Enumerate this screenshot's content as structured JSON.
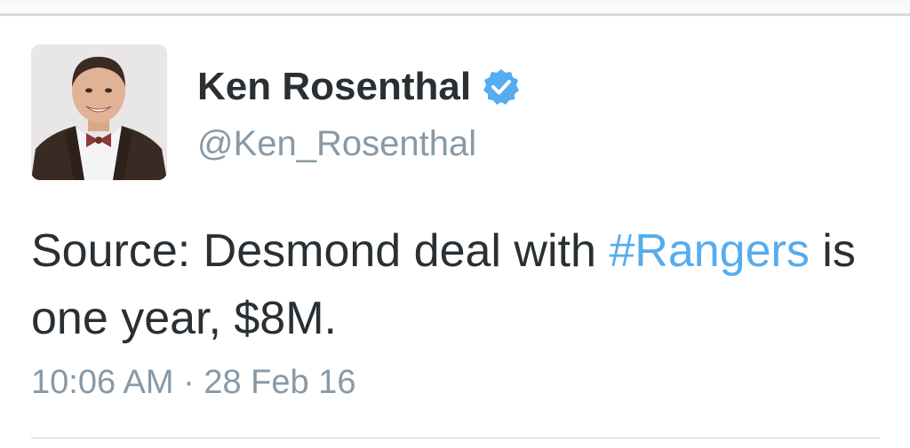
{
  "tweet": {
    "author": {
      "display_name": "Ken Rosenthal",
      "handle": "@Ken_Rosenthal",
      "verified": true,
      "verified_icon": "verified-badge-icon",
      "avatar": "profile-photo"
    },
    "text": {
      "part1": "Source: Desmond deal with ",
      "hashtag": "#Rangers",
      "part2": " is one year, $8M."
    },
    "timestamp": "10:06 AM · 28 Feb 16"
  },
  "colors": {
    "text_primary": "#292f33",
    "text_secondary": "#8899a6",
    "link": "#55acee",
    "verified": "#55acee",
    "divider": "#e1e8ed"
  }
}
